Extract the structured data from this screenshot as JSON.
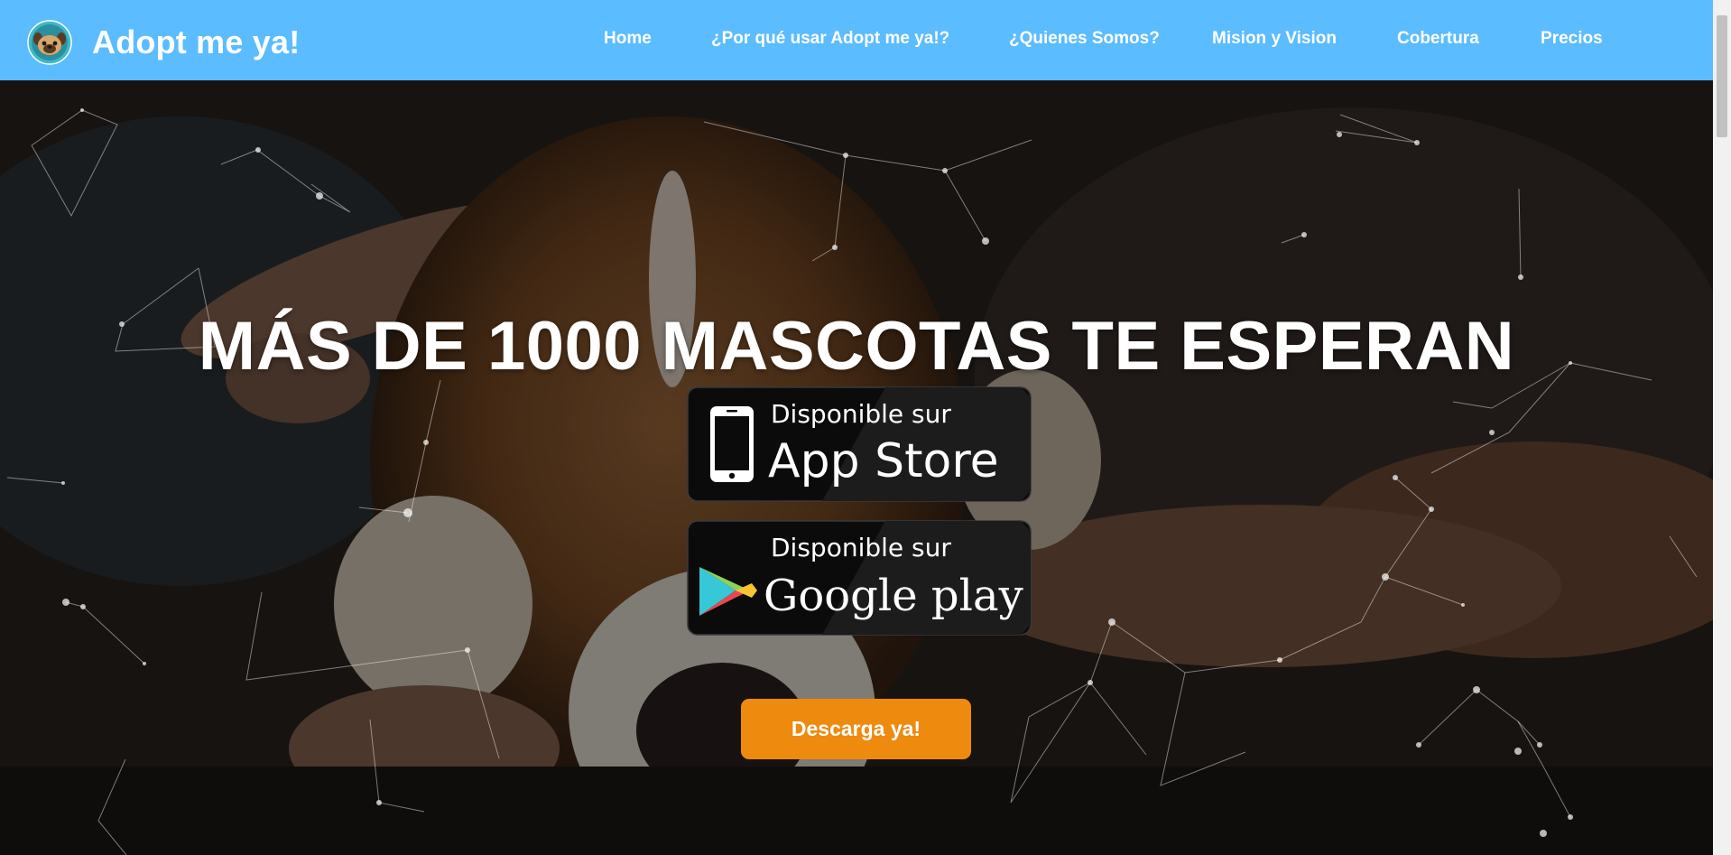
{
  "brand": {
    "name": "Adopt me ya!",
    "logo_icon": "pug-face-logo-icon"
  },
  "nav": {
    "items": [
      {
        "label": "Home"
      },
      {
        "label": "¿Por qué usar Adopt me ya!?"
      },
      {
        "label": "¿Quienes Somos?"
      },
      {
        "label": "Mision y Vision"
      },
      {
        "label": "Cobertura"
      },
      {
        "label": "Precios"
      }
    ]
  },
  "hero": {
    "headline": "MÁS DE 1000 MASCOTAS TE ESPERAN",
    "background_icon": "dog-photo-background",
    "app_store": {
      "top_text": "Disponible sur",
      "store_name": "App Store",
      "icon": "iphone-icon"
    },
    "google_play": {
      "top_text": "Disponible sur",
      "store_name": "Google play",
      "icon": "google-play-icon"
    },
    "cta_label": "Descarga ya!"
  },
  "colors": {
    "navbar": "#5bbcff",
    "cta": "#ee8a0e",
    "text": "#ffffff"
  }
}
